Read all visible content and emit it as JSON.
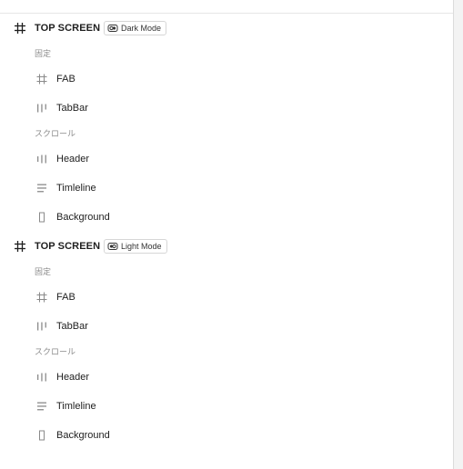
{
  "frames": [
    {
      "title": "TOP SCREEN",
      "mode_label": "Dark Mode",
      "sections": [
        {
          "label": "固定",
          "items": [
            {
              "label": "FAB",
              "icon": "frame-hash-icon"
            },
            {
              "label": "TabBar",
              "icon": "columns-icon"
            }
          ]
        },
        {
          "label": "スクロール",
          "items": [
            {
              "label": "Header",
              "icon": "columns-icon"
            },
            {
              "label": "Timleline",
              "icon": "rows-icon"
            },
            {
              "label": "Background",
              "icon": "rectangle-icon"
            }
          ]
        }
      ]
    },
    {
      "title": "TOP SCREEN",
      "mode_label": "Light Mode",
      "sections": [
        {
          "label": "固定",
          "items": [
            {
              "label": "FAB",
              "icon": "frame-hash-icon"
            },
            {
              "label": "TabBar",
              "icon": "columns-icon"
            }
          ]
        },
        {
          "label": "スクロール",
          "items": [
            {
              "label": "Header",
              "icon": "columns-icon"
            },
            {
              "label": "Timleline",
              "icon": "rows-icon"
            },
            {
              "label": "Background",
              "icon": "rectangle-icon"
            }
          ]
        }
      ]
    }
  ]
}
